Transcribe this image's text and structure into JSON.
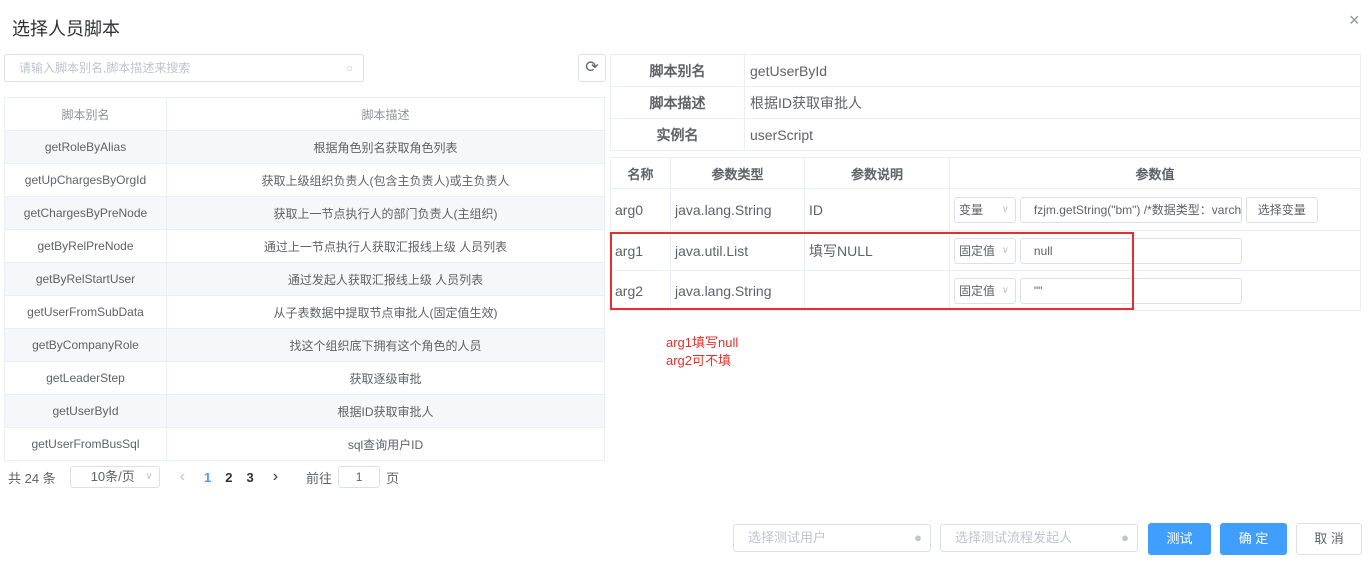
{
  "dialog": {
    "title": "选择人员脚本",
    "close": "×"
  },
  "search": {
    "placeholder": "请输入脚本别名,脚本描述来搜索",
    "icon": "search-icon",
    "refresh": "⟳"
  },
  "scripts": {
    "headers": [
      "脚本别名",
      "脚本描述"
    ],
    "rows": [
      [
        "getRoleByAlias",
        "根据角色别名获取角色列表"
      ],
      [
        "getUpChargesByOrgId",
        "获取上级组织负责人(包含主负责人)或主负责人"
      ],
      [
        "getChargesByPreNode",
        "获取上一节点执行人的部门负责人(主组织)"
      ],
      [
        "getByRelPreNode",
        "通过上一节点执行人获取汇报线上级 人员列表"
      ],
      [
        "getByRelStartUser",
        "通过发起人获取汇报线上级 人员列表"
      ],
      [
        "getUserFromSubData",
        "从子表数据中提取节点审批人(固定值生效)"
      ],
      [
        "getByCompanyRole",
        "找这个组织底下拥有这个角色的人员"
      ],
      [
        "getLeaderStep",
        "获取逐级审批"
      ],
      [
        "getUserById",
        "根据ID获取审批人"
      ],
      [
        "getUserFromBusSql",
        "sql查询用户ID"
      ]
    ]
  },
  "pager": {
    "total": "共 24 条",
    "size": "10条/页",
    "prev": "‹",
    "pages": [
      "1",
      "2",
      "3"
    ],
    "next": "›",
    "goto": "前往",
    "page": "1",
    "page_suffix": "页"
  },
  "info": {
    "rows": [
      [
        "脚本别名",
        "getUserById"
      ],
      [
        "脚本描述",
        "根据ID获取审批人"
      ],
      [
        "实例名",
        "userScript"
      ]
    ]
  },
  "params": {
    "headers": [
      "名称",
      "参数类型",
      "参数说明",
      "参数值"
    ],
    "rows": [
      {
        "name": "arg0",
        "type": "java.lang.String",
        "desc": "ID",
        "mode": "变量",
        "value": "fzjm.getString(\"bm\") /*数据类型：varcha",
        "button": "选择变量"
      },
      {
        "name": "arg1",
        "type": "java.util.List",
        "desc": "填写NULL",
        "mode": "固定值",
        "value": "null"
      },
      {
        "name": "arg2",
        "type": "java.lang.String",
        "desc": "",
        "mode": "固定值",
        "value": "\"\""
      }
    ]
  },
  "annotation": [
    "arg1填写null",
    "arg2可不填"
  ],
  "footer": {
    "test_user": "选择测试用户",
    "test_starter": "选择测试流程发起人",
    "test": "测试",
    "ok": "确 定",
    "cancel": "取 消"
  }
}
